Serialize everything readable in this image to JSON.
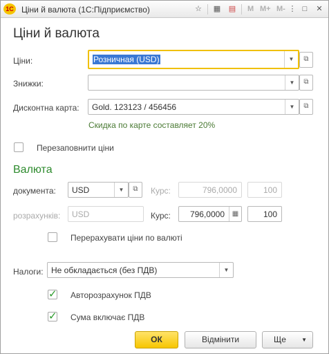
{
  "window": {
    "title": "Ціни й валюта  (1С:Підприємство)",
    "logo": "1С"
  },
  "titlebar_icons": [
    "bookmark-icon",
    "calculator-icon",
    "calendar-icon"
  ],
  "titlebar_memory": [
    "M",
    "M+",
    "M-"
  ],
  "titlebar_controls": {
    "more": "⋮",
    "restore": "□",
    "close": "✕"
  },
  "form": {
    "heading": "Ціни й валюта",
    "prices_label": "Ціни:",
    "prices_value": "Розничная  (USD)",
    "discounts_label": "Знижки:",
    "discounts_value": "",
    "card_label": "Дисконтна карта:",
    "card_value": "Gold. 123123 / 456456",
    "card_hint": "Скидка по карте составляет 20%",
    "refill_label": "Перезаповнити ціни",
    "currency_section": "Валюта",
    "doc_label": "документа:",
    "doc_currency": "USD",
    "rate_label": "Курс:",
    "doc_rate": "796,0000",
    "doc_mult": "100",
    "settle_label": "розрахунків:",
    "settle_currency": "USD",
    "settle_rate": "796,0000",
    "settle_mult": "100",
    "recalc_label": "Перерахувати ціни по валюті",
    "tax_label": "Налоги:",
    "tax_value": "Не обкладається (без ПДВ)",
    "auto_vat_label": "Авторозрахунок ПДВ",
    "sum_incl_vat_label": "Сума включає ПДВ"
  },
  "buttons": {
    "ok": "ОК",
    "cancel": "Відмінити",
    "more": "Ще"
  },
  "colors": {
    "accent_section": "#2e8b2e",
    "ok_button": "#f7c600",
    "focus_border": "#f0c000"
  }
}
